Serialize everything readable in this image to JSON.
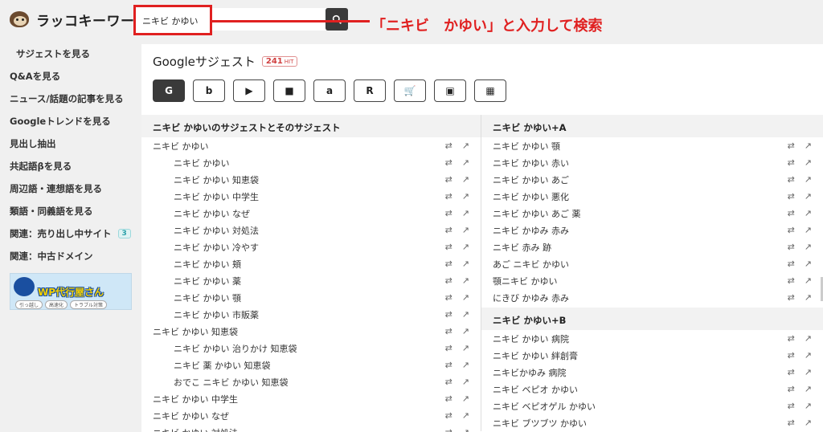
{
  "header": {
    "logo_text": "ラッコキーワード",
    "search_value": "ニキビ かゆい",
    "annotation": "「ニキビ　かゆい」と入力して検索"
  },
  "sidebar": {
    "items": [
      {
        "label": "サジェストを見る"
      },
      {
        "label": "Q&Aを見る"
      },
      {
        "label": "ニュース/話題の記事を見る"
      },
      {
        "label": "Googleトレンドを見る"
      },
      {
        "label": "見出し抽出"
      },
      {
        "label": "共起語βを見る"
      },
      {
        "label": "周辺語・連想語を見る"
      },
      {
        "label": "類語・同義語を見る"
      },
      {
        "label": "関連：売り出し中サイト",
        "badge": "3"
      },
      {
        "label": "関連：中古ドメイン"
      }
    ],
    "banner": {
      "title": "WP代行屋さん",
      "pills": [
        "引っ越し",
        "高速化",
        "トラブル対策"
      ]
    }
  },
  "main": {
    "title": "Googleサジェスト",
    "hit_count": "241",
    "hit_label": "HIT",
    "engines": [
      {
        "name": "google-icon",
        "glyph": "G"
      },
      {
        "name": "bing-icon",
        "glyph": "b"
      },
      {
        "name": "youtube-icon",
        "glyph": "▶"
      },
      {
        "name": "video-icon",
        "glyph": "■"
      },
      {
        "name": "amazon-icon",
        "glyph": "a"
      },
      {
        "name": "rakuten-icon",
        "glyph": "R"
      },
      {
        "name": "shopping-cart-icon",
        "glyph": "🛒"
      },
      {
        "name": "image-icon",
        "glyph": "▣"
      },
      {
        "name": "grid-icon",
        "glyph": "▦"
      }
    ],
    "left_column": {
      "header": "ニキビ かゆいのサジェストとそのサジェスト",
      "rows": [
        {
          "text": "ニキビ かゆい",
          "sub": false
        },
        {
          "text": "ニキビ かゆい",
          "sub": true
        },
        {
          "text": "ニキビ かゆい 知恵袋",
          "sub": true
        },
        {
          "text": "ニキビ かゆい 中学生",
          "sub": true
        },
        {
          "text": "ニキビ かゆい なぜ",
          "sub": true
        },
        {
          "text": "ニキビ かゆい 対処法",
          "sub": true
        },
        {
          "text": "ニキビ かゆい 冷やす",
          "sub": true
        },
        {
          "text": "ニキビ かゆい 頬",
          "sub": true
        },
        {
          "text": "ニキビ かゆい 薬",
          "sub": true
        },
        {
          "text": "ニキビ かゆい 顎",
          "sub": true
        },
        {
          "text": "ニキビ かゆい 市販薬",
          "sub": true
        },
        {
          "text": "ニキビ かゆい 知恵袋",
          "sub": false
        },
        {
          "text": "ニキビ かゆい 治りかけ 知恵袋",
          "sub": true
        },
        {
          "text": "ニキビ 薬 かゆい 知恵袋",
          "sub": true
        },
        {
          "text": "おでこ ニキビ かゆい 知恵袋",
          "sub": true
        },
        {
          "text": "ニキビ かゆい 中学生",
          "sub": false
        },
        {
          "text": "ニキビ かゆい なぜ",
          "sub": false
        },
        {
          "text": "ニキビ かゆい 対処法",
          "sub": false
        }
      ]
    },
    "right_column_a": {
      "header": "ニキビ かゆい+A",
      "rows": [
        "ニキビ かゆい 顎",
        "ニキビ かゆい 赤い",
        "ニキビ かゆい あご",
        "ニキビ かゆい 悪化",
        "ニキビ かゆい あご 薬",
        "ニキビ かゆみ 赤み",
        "ニキビ 赤み 跡",
        "あご ニキビ かゆい",
        "顎ニキビ かゆい",
        "にきび かゆみ 赤み"
      ]
    },
    "right_column_b": {
      "header": "ニキビ かゆい+B",
      "rows": [
        "ニキビ かゆい 病院",
        "ニキビ かゆい 絆創膏",
        "ニキビかゆみ 病院",
        "ニキビ ベピオ かゆい",
        "ニキビ ベピオゲル かゆい",
        "ニキビ ブツブツ かゆい"
      ]
    },
    "row_actions": [
      {
        "name": "copy-icon",
        "glyph": "⇄"
      },
      {
        "name": "external-link-icon",
        "glyph": "↗"
      }
    ]
  }
}
